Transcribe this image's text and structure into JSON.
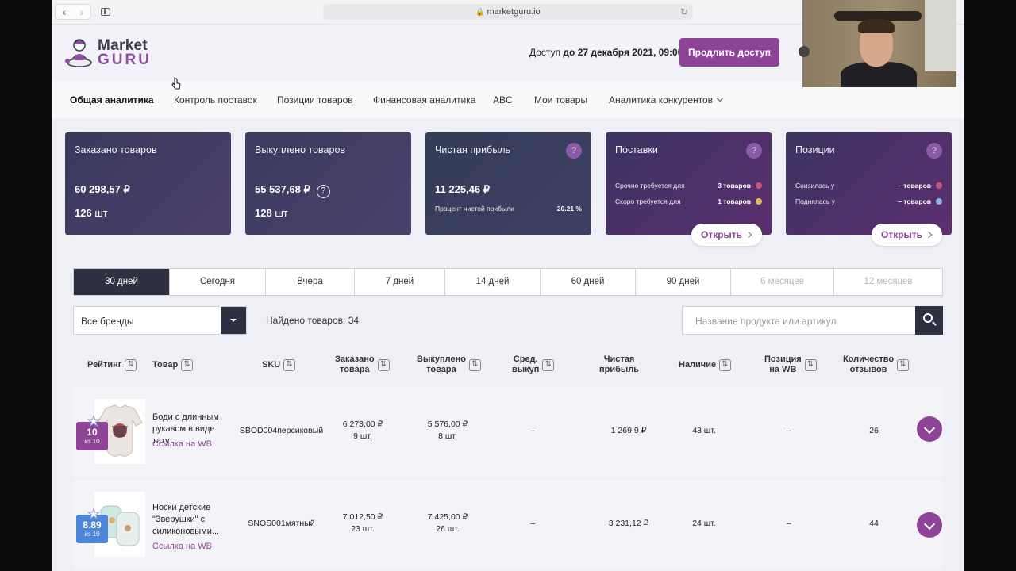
{
  "browser": {
    "url": "marketguru.io"
  },
  "header": {
    "logo_top": "Market",
    "logo_bottom": "GURU",
    "access_prefix": "Доступ",
    "access_date": "до 27 декабря 2021, 09:00",
    "extend_label": "Продлить доступ"
  },
  "menu": {
    "items": [
      "Общая аналитика",
      "Контроль поставок",
      "Позиции товаров",
      "Финансовая аналитика",
      "ABC",
      "Мои товары",
      "Аналитика конкурентов"
    ]
  },
  "cards": {
    "ordered": {
      "title": "Заказано товаров",
      "amount": "60 298,57 ₽",
      "count": "126",
      "unit": "шт"
    },
    "bought": {
      "title": "Выкуплено товаров",
      "amount": "55 537,68 ₽",
      "count": "128",
      "unit": "шт"
    },
    "profit": {
      "title": "Чистая прибыль",
      "amount": "11 225,46 ₽",
      "percent_label": "Процент чистой прибыли",
      "percent_value": "20.21 %"
    },
    "supplies": {
      "title": "Поставки",
      "row1_label": "Срочно требуется для",
      "row1_value": "3 товаров",
      "row2_label": "Скоро требуется для",
      "row2_value": "1 товаров",
      "open": "Открыть"
    },
    "positions": {
      "title": "Позиции",
      "row1_label": "Снизилась у",
      "row1_value": "– товаров",
      "row2_label": "Поднялась у",
      "row2_value": "– товаров",
      "open": "Открыть"
    },
    "help": "?"
  },
  "periods": [
    "30 дней",
    "Сегодня",
    "Вчера",
    "7 дней",
    "14 дней",
    "60 дней",
    "90 дней",
    "6 месяцев",
    "12 месяцев"
  ],
  "filters": {
    "brand": "Все бренды",
    "found": "Найдено товаров: 34",
    "search_placeholder": "Название продукта или артикул"
  },
  "table": {
    "headers": {
      "rating": "Рейтинг",
      "product": "Товар",
      "sku": "SKU",
      "ordered1": "Заказано",
      "ordered2": "товара",
      "bought1": "Выкуплено",
      "bought2": "товара",
      "avg1": "Сред.",
      "avg2": "выкуп",
      "profit1": "Чистая",
      "profit2": "прибыль",
      "stock": "Наличие",
      "pos1": "Позиция",
      "pos2": "на WB",
      "reviews1": "Количество",
      "reviews2": "отзывов"
    },
    "rows": [
      {
        "rating": "10",
        "rating_of": "из 10",
        "rating_color": "#8d4396",
        "name": "Боди с длинным рукавом в виде тату",
        "link": "Ссылка на WB",
        "sku": "SBOD004персиковый",
        "ordered_sum": "6 273,00 ₽",
        "ordered_qty": "9 шт.",
        "bought_sum": "5 576,00 ₽",
        "bought_qty": "8 шт.",
        "avg": "–",
        "profit": "1 269,9 ₽",
        "stock": "43 шт.",
        "position": "–",
        "reviews": "26"
      },
      {
        "rating": "8.89",
        "rating_of": "из 10",
        "rating_color": "#4d86d9",
        "name": "Носки детские \"Зверушки\" с силиконовыми...",
        "link": "Ссылка на WB",
        "sku": "SNOS001мятный",
        "ordered_sum": "7 012,50 ₽",
        "ordered_qty": "23 шт.",
        "bought_sum": "7 425,00 ₽",
        "bought_qty": "26 шт.",
        "avg": "–",
        "profit": "3 231,12 ₽",
        "stock": "24 шт.",
        "position": "–",
        "reviews": "44"
      }
    ]
  },
  "colors": {
    "accent": "#8d4396",
    "dark": "#2f3042",
    "dot_red": "#c6577a",
    "dot_yellow": "#e5b85c",
    "dot_blue": "#8eb5dc",
    "dot_pink": "#c6577a"
  }
}
